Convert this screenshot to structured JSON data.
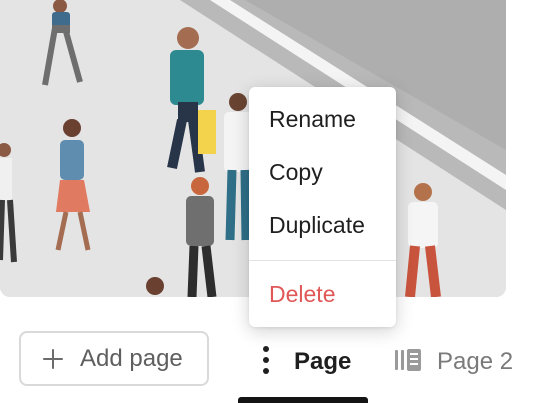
{
  "context_menu": {
    "items": [
      {
        "label": "Rename"
      },
      {
        "label": "Copy"
      },
      {
        "label": "Duplicate"
      }
    ],
    "delete_label": "Delete",
    "delete_color": "#e05757"
  },
  "page_bar": {
    "add_page_label": "Add page",
    "tabs": [
      {
        "label": "Page",
        "active": true
      },
      {
        "label": "Page 2",
        "active": false
      }
    ]
  },
  "icons": {
    "add": "plus-icon",
    "page_options": "more-vertical-icon",
    "page_thumbnail": "page-doc-icon"
  },
  "colors": {
    "active_indicator": "#141414",
    "menu_text": "#1f1f1f",
    "inactive_tab_text": "#7a7a7a"
  }
}
